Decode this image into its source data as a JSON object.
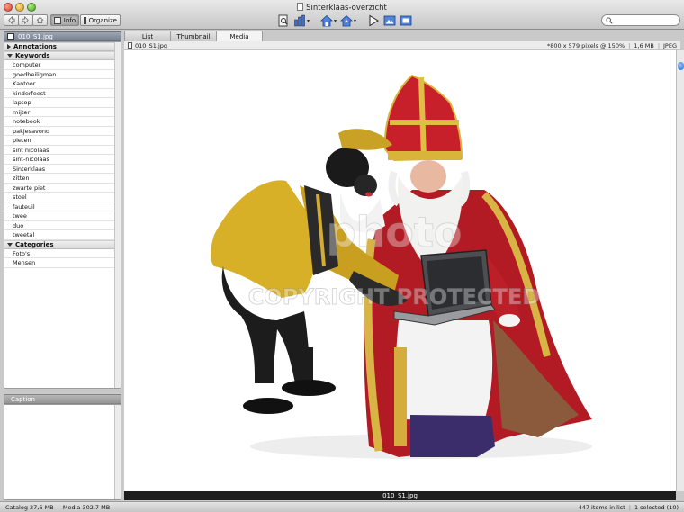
{
  "window": {
    "title": "Sinterklaas-overzicht"
  },
  "toolbar": {
    "info_label": "Info",
    "organize_label": "Organize"
  },
  "search": {
    "placeholder": ""
  },
  "sidebar": {
    "thumb_label": "010_S1.jpg",
    "sections": {
      "annotations": "Annotations",
      "keywords": "Keywords",
      "categories": "Categories"
    },
    "keywords": [
      "computer",
      "goedheiligman",
      "Kantoor",
      "kinderfeest",
      "laptop",
      "mijter",
      "notebook",
      "pakjesavond",
      "pieten",
      "sint nicolaas",
      "sint-nicolaas",
      "Sinterklaas",
      "zitten",
      "zwarte piet",
      "stoel",
      "fauteuil",
      "twee",
      "duo",
      "tweetal"
    ],
    "categories": [
      "Foto's",
      "Mensen"
    ]
  },
  "caption": {
    "label": "Caption"
  },
  "tabs": [
    "List",
    "Thumbnail",
    "Media"
  ],
  "infobar": {
    "filename": "010_S1.jpg",
    "dimensions": "*800 x 579 pixels @ 150%",
    "size": "1,6 MB",
    "format": "JPEG"
  },
  "viewer": {
    "watermark_line1": "photo",
    "watermark_line2": "COPYRIGHT PROTECTED",
    "filename": "010_S1.jpg"
  },
  "status": {
    "catalog": "Catalog  27,6 MB",
    "media": "Media 302,7 MB",
    "items": "447 items in list",
    "selected": "1 selected (10)"
  },
  "colors": {
    "sidebar_tab": "#8a929e",
    "mitre_red": "#c8202a",
    "gold": "#d9b43a",
    "viewer_bg": "#ffffff"
  }
}
